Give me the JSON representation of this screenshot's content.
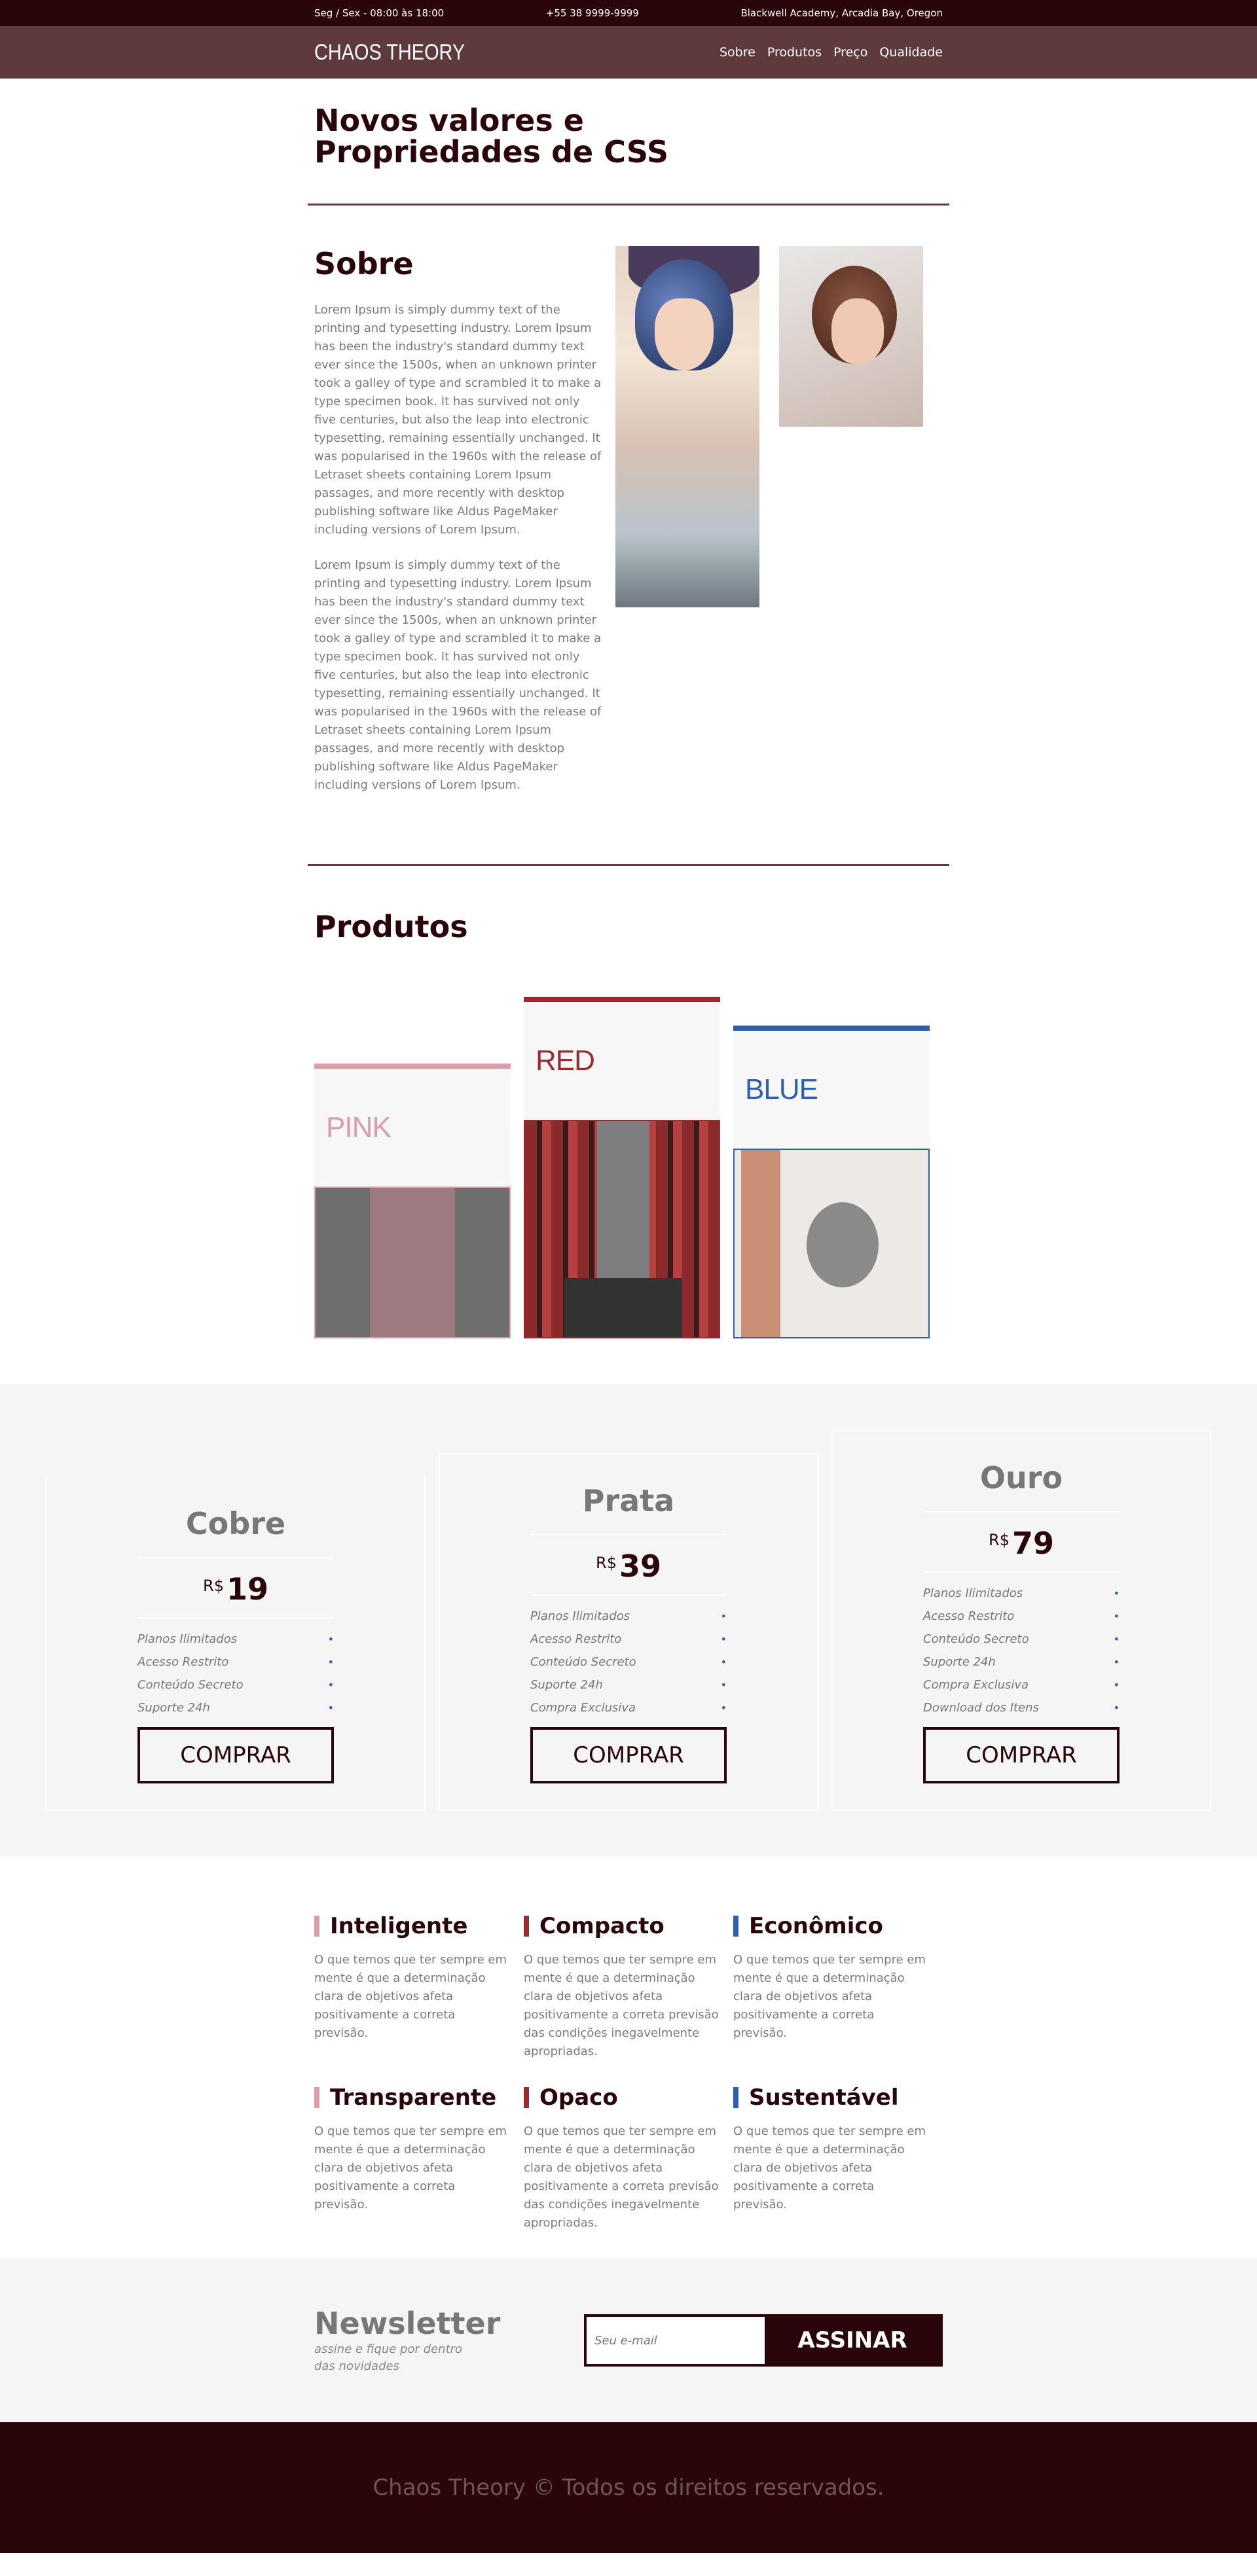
{
  "topbar": {
    "hours": "Seg / Sex - 08:00 às 18:00",
    "phone": "+55 38 9999-9999",
    "address": "Blackwell Academy, Arcadia Bay, Oregon"
  },
  "header": {
    "logo": "CHAOS THEORY",
    "nav": [
      "Sobre",
      "Produtos",
      "Preço",
      "Qualidade"
    ]
  },
  "intro": {
    "title_line1": "Novos valores e",
    "title_line2": "Propriedades de CSS"
  },
  "sobre": {
    "title": "Sobre",
    "paragraphs": [
      "Lorem Ipsum is simply dummy text of the printing and typesetting industry. Lorem Ipsum has been the industry's standard dummy text ever since the 1500s, when an unknown printer took a galley of type and scrambled it to make a type specimen book. It has survived not only five centuries, but also the leap into electronic typesetting, remaining essentially unchanged. It was popularised in the 1960s with the release of Letraset sheets containing Lorem Ipsum passages, and more recently with desktop publishing software like Aldus PageMaker including versions of Lorem Ipsum.",
      "Lorem Ipsum is simply dummy text of the printing and typesetting industry. Lorem Ipsum has been the industry's standard dummy text ever since the 1500s, when an unknown printer took a galley of type and scrambled it to make a type specimen book. It has survived not only five centuries, but also the leap into electronic typesetting, remaining essentially unchanged. It was popularised in the 1960s with the release of Letraset sheets containing Lorem Ipsum passages, and more recently with desktop publishing software like Aldus PageMaker including versions of Lorem Ipsum."
    ]
  },
  "produtos": {
    "title": "Produtos",
    "items": [
      {
        "label": "PINK",
        "color": "#d99fa8"
      },
      {
        "label": "RED",
        "color": "#9b2b2f"
      },
      {
        "label": "BLUE",
        "color": "#2d5fae"
      }
    ]
  },
  "pricing": {
    "currency": "R$",
    "buy_label": "COMPRAR",
    "plans": [
      {
        "name": "Cobre",
        "price": "19",
        "features": [
          "Planos Ilimitados",
          "Acesso Restrito",
          "Conteúdo Secreto",
          "Suporte 24h"
        ]
      },
      {
        "name": "Prata",
        "price": "39",
        "features": [
          "Planos Ilimitados",
          "Acesso Restrito",
          "Conteúdo Secreto",
          "Suporte 24h",
          "Compra Exclusiva"
        ]
      },
      {
        "name": "Ouro",
        "price": "79",
        "features": [
          "Planos Ilimitados",
          "Acesso Restrito",
          "Conteúdo Secreto",
          "Suporte 24h",
          "Compra Exclusiva",
          "Download dos Itens"
        ]
      }
    ]
  },
  "features": {
    "items": [
      {
        "title": "Inteligente",
        "text": "O que temos que ter sempre em mente é que a determinação clara de objetivos afeta positivamente a correta previsão."
      },
      {
        "title": "Compacto",
        "text": "O que temos que ter sempre em mente é que a determinação clara de objetivos afeta positivamente a correta previsão das condições inegavelmente apropriadas."
      },
      {
        "title": "Econômico",
        "text": "O que temos que ter sempre em mente é que a determinação clara de objetivos afeta positivamente a correta previsão."
      },
      {
        "title": "Transparente",
        "text": "O que temos que ter sempre em mente é que a determinação clara de objetivos afeta positivamente a correta previsão."
      },
      {
        "title": "Opaco",
        "text": "O que temos que ter sempre em mente é que a determinação clara de objetivos afeta positivamente a correta previsão das condições inegavelmente apropriadas."
      },
      {
        "title": "Sustentável",
        "text": "O que temos que ter sempre em mente é que a determinação clara de objetivos afeta positivamente a correta previsão."
      }
    ]
  },
  "newsletter": {
    "title": "Newsletter",
    "subtitle": "assine e fique por dentro das novidades",
    "placeholder": "Seu e-mail",
    "button": "ASSINAR"
  },
  "footer": {
    "text": "Chaos Theory © Todos os direitos reservados."
  },
  "colors": {
    "dark": "#2a0509",
    "header": "#5e3a3c",
    "pink": "#d99fa8",
    "red": "#9b2b2f",
    "blue": "#2d5fae"
  }
}
